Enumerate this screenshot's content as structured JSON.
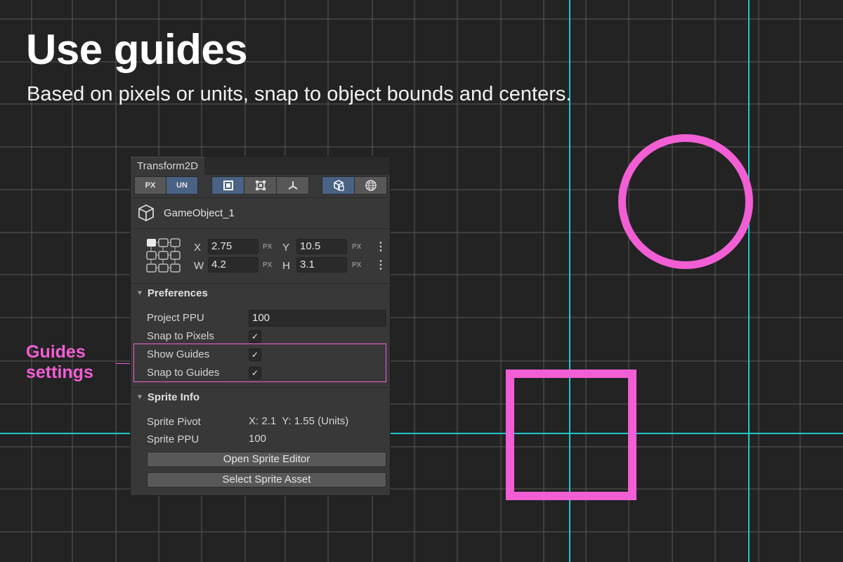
{
  "headline": "Use guides",
  "subline": "Based on pixels or units, snap to object bounds and centers.",
  "callout": {
    "line1": "Guides",
    "line2": "settings"
  },
  "colors": {
    "accent": "#f25ed4",
    "guide": "#1fc9c9",
    "grid": "#5a5a5a",
    "background": "#232323"
  },
  "panel": {
    "tab": "Transform2D",
    "toolbar": {
      "px": "PX",
      "un": "UN",
      "icons": [
        "rect-select-icon",
        "bounds-icon",
        "pivot-icon",
        "local-space-icon",
        "global-space-icon"
      ]
    },
    "object_name": "GameObject_1",
    "transform": {
      "x_label": "X",
      "x_value": "2.75",
      "x_unit": "PX",
      "y_label": "Y",
      "y_value": "10.5",
      "y_unit": "PX",
      "w_label": "W",
      "w_value": "4.2",
      "w_unit": "PX",
      "h_label": "H",
      "h_value": "3.1",
      "h_unit": "PX",
      "more": "⋮"
    },
    "preferences": {
      "title": "Preferences",
      "project_ppu_label": "Project PPU",
      "project_ppu_value": "100",
      "snap_pixels_label": "Snap to Pixels",
      "show_guides_label": "Show Guides",
      "snap_guides_label": "Snap to Guides",
      "check": "✓"
    },
    "sprite_info": {
      "title": "Sprite Info",
      "pivot_label": "Sprite Pivot",
      "pivot_value": "X: 2.1  Y: 1.55 (Units)",
      "ppu_label": "Sprite PPU",
      "ppu_value": "100",
      "open_editor": "Open Sprite Editor",
      "select_asset": "Select Sprite Asset"
    }
  }
}
